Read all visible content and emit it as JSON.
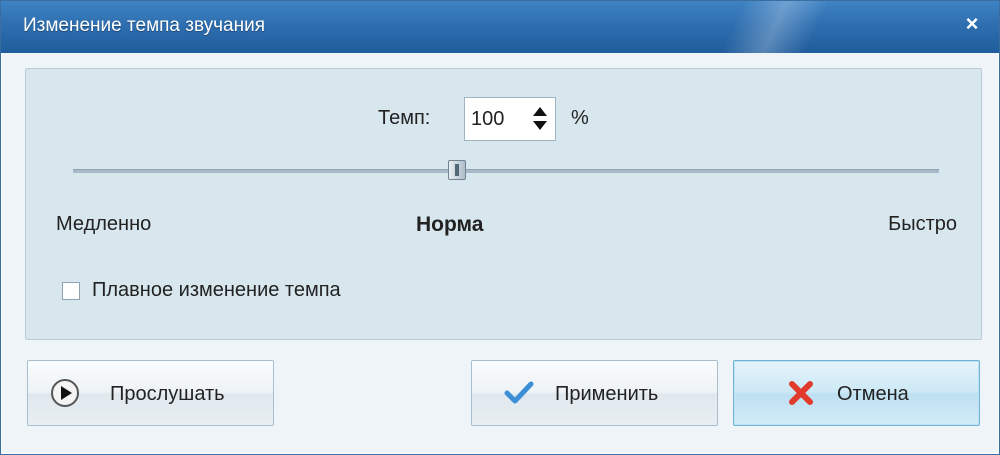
{
  "window": {
    "title": "Изменение темпа звучания",
    "close_glyph": "×"
  },
  "tempo": {
    "label": "Темп:",
    "value": "100",
    "unit": "%"
  },
  "slider": {
    "value_percent": 100,
    "position_fraction": 0.435,
    "min_label": "Медленно",
    "mid_label": "Норма",
    "max_label": "Быстро"
  },
  "smooth_change": {
    "label": "Плавное изменение темпа",
    "checked": false
  },
  "buttons": {
    "listen": {
      "label": "Прослушать",
      "icon": "play-icon"
    },
    "apply": {
      "label": "Применить",
      "icon": "checkmark-icon"
    },
    "cancel": {
      "label": "Отмена",
      "icon": "red-x-icon"
    }
  },
  "colors": {
    "titlebar": "#2f6fb0",
    "panel": "#d8e6ee",
    "accent_cancel": "#cde9f6",
    "cancel_icon": "#e23b2e",
    "check_icon": "#3c8fd6"
  }
}
